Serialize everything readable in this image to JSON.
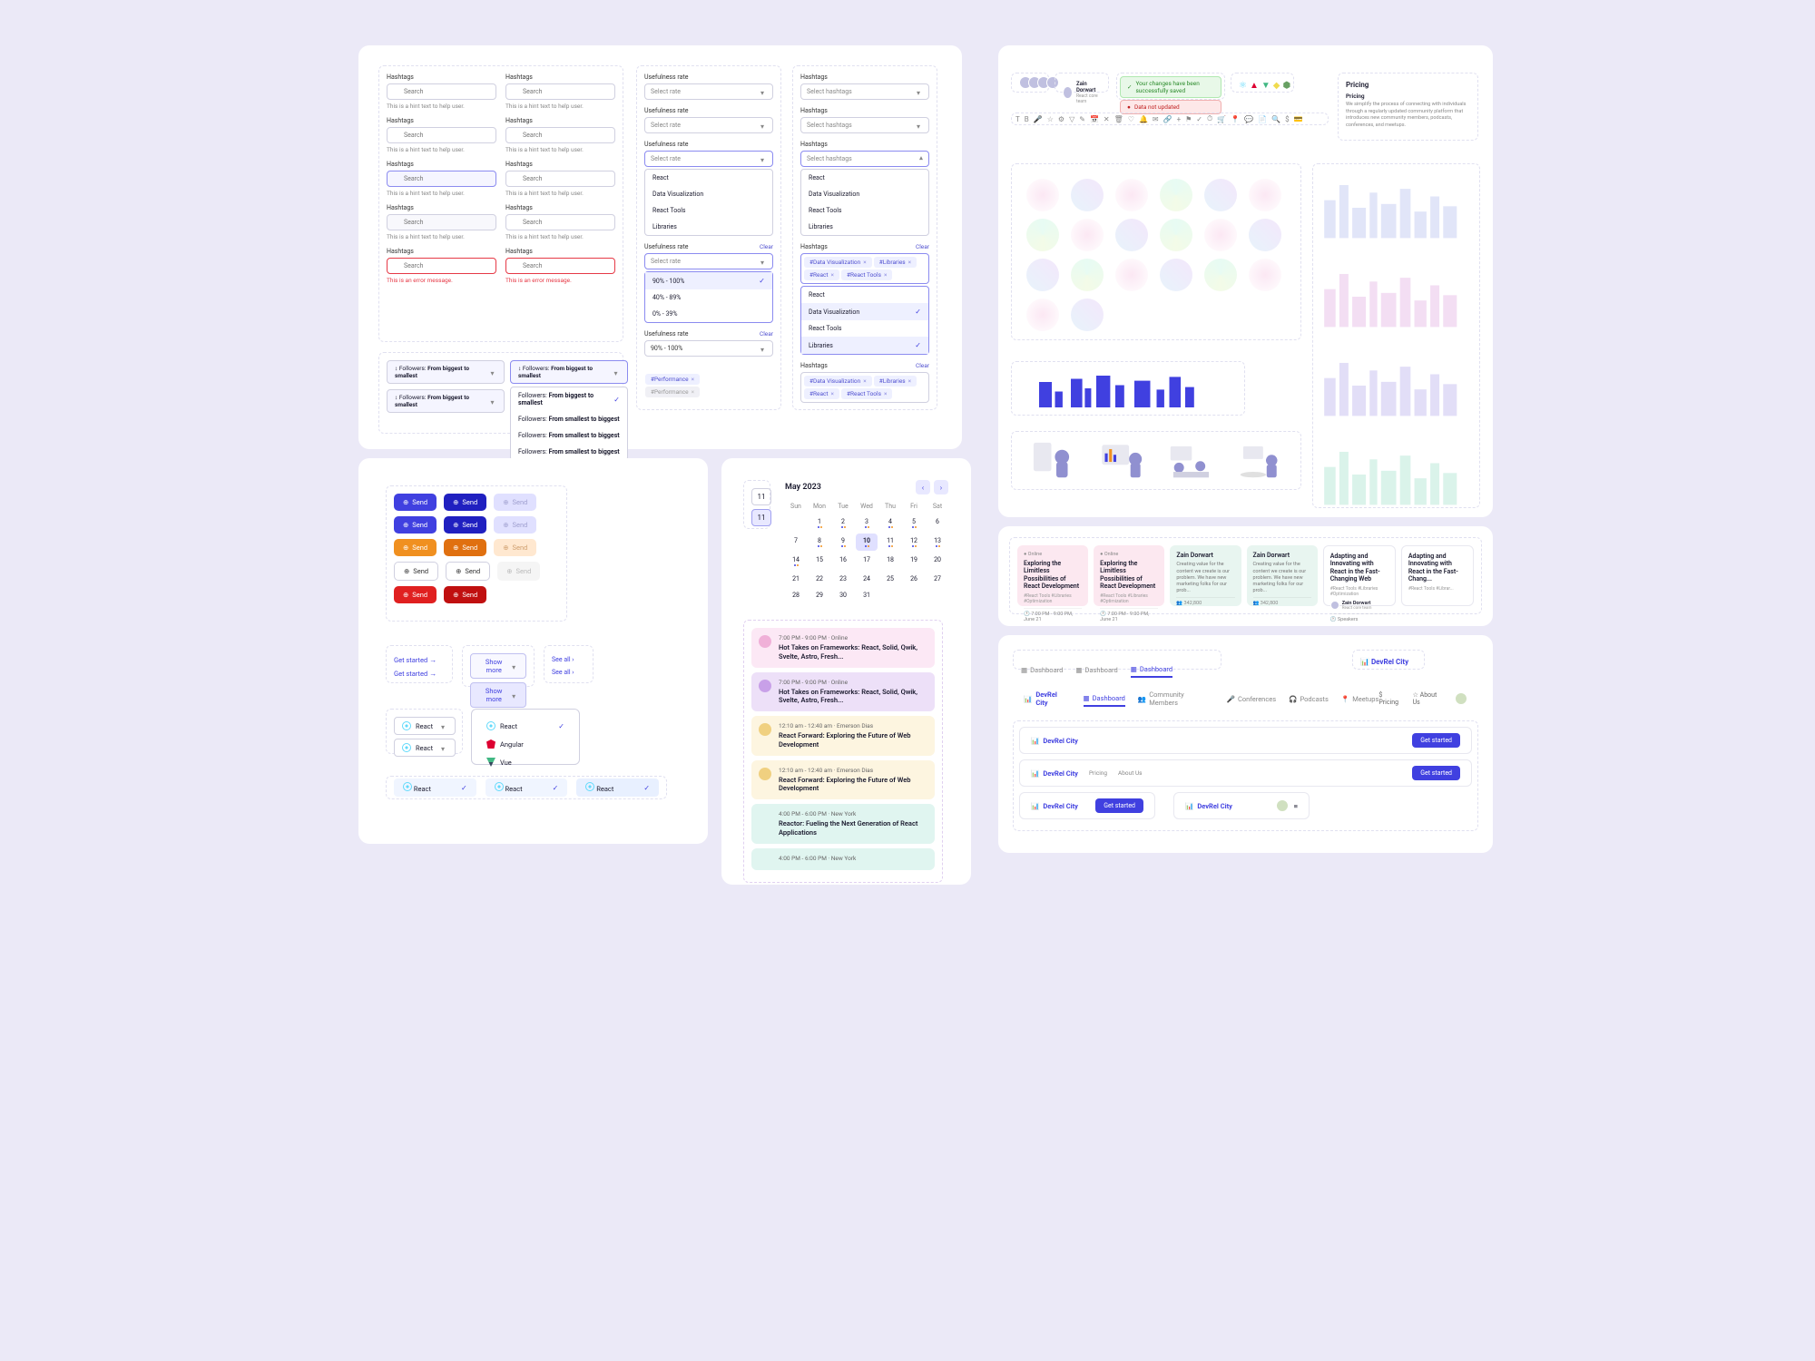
{
  "forms": {
    "hashtag_label": "Hashtags",
    "search_ph": "Search",
    "hint": "This is a hint text to help user.",
    "error": "This is an error message.",
    "usefulness_label": "Usefulness rate",
    "select_rate_ph": "Select rate",
    "select_hashtags_ph": "Select hashtags",
    "clear": "Clear",
    "rate_options": [
      "90% - 100%",
      "40% - 89%",
      "0% - 39%"
    ],
    "hashtag_options": [
      "React",
      "Data Visualization",
      "React Tools",
      "Libraries"
    ],
    "selected_rate": "90% - 100%",
    "chips": {
      "dataviz": "#Data Visualization",
      "libraries": "#Libraries",
      "react": "#React",
      "reacttools": "#React Tools",
      "performance": "#Performance"
    },
    "sort": {
      "label_prefix": "Followers:",
      "big_to_small": "From biggest to smallest",
      "small_to_big": "From smallest to biggest"
    }
  },
  "buttons": {
    "send": "Send",
    "get_started": "Get started",
    "show_more": "Show more",
    "see_all": "See all"
  },
  "frameworks": {
    "react": "React",
    "angular": "Angular",
    "vue": "Vue"
  },
  "calendar": {
    "month": "May 2023",
    "days": [
      "Sun",
      "Mon",
      "Tue",
      "Wed",
      "Thu",
      "Fri",
      "Sat"
    ],
    "weeks": [
      [
        "",
        "1",
        "2",
        "3",
        "4",
        "5",
        "6"
      ],
      [
        "7",
        "8",
        "9",
        "10",
        "11",
        "12",
        "13"
      ],
      [
        "14",
        "15",
        "16",
        "17",
        "18",
        "19",
        "20"
      ],
      [
        "21",
        "22",
        "23",
        "24",
        "25",
        "26",
        "27"
      ],
      [
        "28",
        "29",
        "30",
        "31",
        "",
        "",
        ""
      ]
    ],
    "tiles": [
      "11",
      "11"
    ],
    "today": "10",
    "events": [
      {
        "time": "7:00 PM - 9:00 PM",
        "loc": "Online",
        "title": "Hot Takes on Frameworks: React, Solid, Qwik, Svelte, Astro, Fresh...",
        "cls": "ev-pink"
      },
      {
        "time": "7:00 PM - 9:00 PM",
        "loc": "Online",
        "title": "Hot Takes on Frameworks: React, Solid, Qwik, Svelte, Astro, Fresh...",
        "cls": "ev-purple"
      },
      {
        "time": "12:10 am - 12:40 am",
        "loc": "Emerson Dias",
        "title": "React Forward: Exploring the Future of Web Development",
        "cls": "ev-yellow"
      },
      {
        "time": "12:10 am - 12:40 am",
        "loc": "Emerson Dias",
        "title": "React Forward: Exploring the Future of Web Development",
        "cls": "ev-yellow"
      },
      {
        "time": "4:00 PM - 6:00 PM",
        "loc": "New York",
        "title": "Reactor: Fueling the Next Generation of React Applications",
        "cls": "ev-teal"
      },
      {
        "time": "4:00 PM - 6:00 PM",
        "loc": "New York",
        "title": "",
        "cls": "ev-teal"
      }
    ]
  },
  "rightTop": {
    "user": {
      "name": "Zain Dorwart",
      "role": "React core team"
    },
    "alert_success": "Your changes have been successfully saved",
    "alert_error": "Data not updated",
    "heading_label": "Pricing",
    "heading_sub": "Pricing",
    "heading_body": "We simplify the process of connecting with individuals through a regularly updated community platform that introduces new community members, podcasts, conferences, and meetups."
  },
  "cards": [
    {
      "cls": "ec-pink",
      "badge": "Online",
      "title": "Exploring the Limitless Possibilities of React Development",
      "tags": "#React Tools  #Libraries  #Optimization",
      "foot": "7:00 PM - 9:00 PM, June 21"
    },
    {
      "cls": "ec-pink",
      "badge": "Online",
      "title": "Exploring the Limitless Possibilities of React Development",
      "tags": "#React Tools  #Libraries  #Optimization",
      "foot": "7:00 PM - 9:00 PM, June 21"
    },
    {
      "cls": "ec-teal",
      "badge": "",
      "title": "Zain Dorwart",
      "body": "Creating value for the content we create is our problem. We have new marketing folks for our prob...",
      "foot": "342,800"
    },
    {
      "cls": "ec-teal",
      "badge": "",
      "title": "Zain Dorwart",
      "body": "Creating value for the content we create is our problem. We have new marketing folks for our prob...",
      "foot": "342,800"
    },
    {
      "cls": "ec-white",
      "badge": "",
      "title": "Adapting and Innovating with React in the Fast-Changing Web",
      "tags": "#React Tools  #Libraries  #Optimization",
      "user": "Zain Dorwart",
      "role": "React core team",
      "foot": "Speakers"
    },
    {
      "cls": "ec-white",
      "badge": "",
      "title": "Adapting and Innovating with React in the Fast-Chang...",
      "tags": "#React Tools  #Librar...",
      "foot": ""
    }
  ],
  "nav": {
    "tabs": [
      "Dashboard",
      "Dashboard",
      "Dashboard"
    ],
    "brand": "DevRel City",
    "main_tabs": [
      "Dashboard",
      "Community Members",
      "Conferences",
      "Podcasts",
      "Meetups"
    ],
    "right_links": [
      "Pricing",
      "About Us"
    ],
    "get_started": "Get started",
    "small_links": [
      "Pricing",
      "About Us"
    ]
  }
}
